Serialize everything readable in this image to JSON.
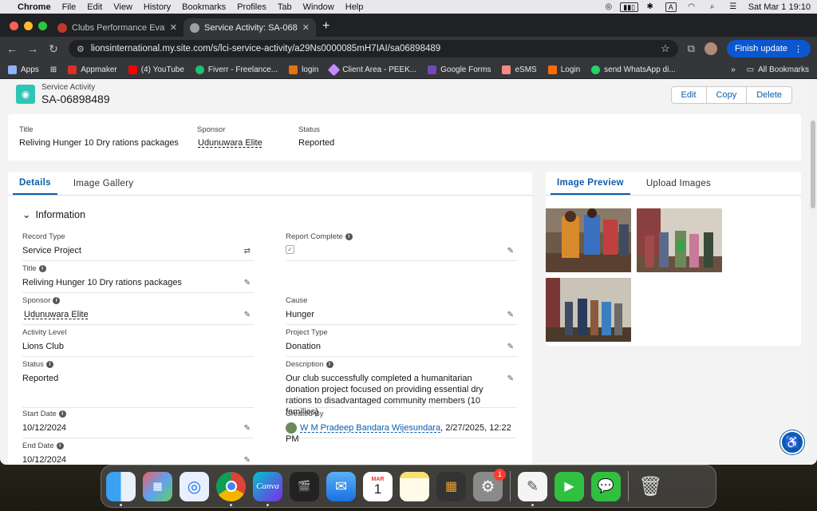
{
  "menubar": {
    "app": "Chrome",
    "menus": [
      "File",
      "Edit",
      "View",
      "History",
      "Bookmarks",
      "Profiles",
      "Tab",
      "Window",
      "Help"
    ],
    "clock": "Sat Mar 1  19:10",
    "input_source": "A"
  },
  "browser": {
    "tabs": [
      {
        "title": "Clubs Performance Evaluation"
      },
      {
        "title": "Service Activity: SA-068984"
      }
    ],
    "url": "lionsinternational.my.site.com/s/lci-service-activity/a29Ns0000085mH7IAI/sa06898489",
    "finish_update": "Finish update",
    "bookmarks": [
      {
        "label": "Apps",
        "color": "#8ab4f8"
      },
      {
        "label": "Appmaker",
        "color": "#d93025"
      },
      {
        "label": "(4) YouTube",
        "color": "#ff0000"
      },
      {
        "label": "Fiverr - Freelance...",
        "color": "#1dbf73"
      },
      {
        "label": "login",
        "color": "#e8710a"
      },
      {
        "label": "Client Area - PEEK...",
        "color": "#c58af9"
      },
      {
        "label": "Google Forms",
        "color": "#7248b9"
      },
      {
        "label": "eSMS",
        "color": "#f28b82"
      },
      {
        "label": "Login",
        "color": "#ff6d00"
      },
      {
        "label": "send WhatsApp di...",
        "color": "#25d366"
      }
    ],
    "all_bookmarks": "All Bookmarks"
  },
  "record": {
    "type_label": "Service Activity",
    "name": "SA-06898489",
    "actions": {
      "edit": "Edit",
      "copy": "Copy",
      "delete": "Delete"
    }
  },
  "highlights": {
    "title_label": "Title",
    "title_value": "Reliving Hunger 10 Dry rations packages",
    "sponsor_label": "Sponsor",
    "sponsor_value": "Udunuwara Elite",
    "status_label": "Status",
    "status_value": "Reported"
  },
  "details_tabs": {
    "details": "Details",
    "gallery": "Image Gallery"
  },
  "section": {
    "information": "Information"
  },
  "fields": {
    "record_type": {
      "label": "Record Type",
      "value": "Service Project"
    },
    "report_complete": {
      "label": "Report Complete"
    },
    "title": {
      "label": "Title",
      "value": "Reliving Hunger 10 Dry rations packages"
    },
    "sponsor": {
      "label": "Sponsor",
      "value": "Udunuwara Elite"
    },
    "cause": {
      "label": "Cause",
      "value": "Hunger"
    },
    "activity_level": {
      "label": "Activity Level",
      "value": "Lions Club"
    },
    "project_type": {
      "label": "Project Type",
      "value": "Donation"
    },
    "status": {
      "label": "Status",
      "value": "Reported"
    },
    "description": {
      "label": "Description",
      "value": "Our club successfully completed a humanitarian donation project focused on providing essential dry rations to disadvantaged community members (10 families)"
    },
    "start_date": {
      "label": "Start Date",
      "value": "10/12/2024"
    },
    "created_by": {
      "label": "Created By",
      "name": "W M Pradeep Bandara Wijesundara",
      "date": ", 2/27/2025, 12:22 PM"
    },
    "end_date": {
      "label": "End Date",
      "value": "10/12/2024"
    }
  },
  "image_tabs": {
    "preview": "Image Preview",
    "upload": "Upload Images"
  },
  "dock": {
    "mail_month": "MAR",
    "mail_day": "1",
    "settings_badge": "1",
    "canva_label": "Canva"
  }
}
